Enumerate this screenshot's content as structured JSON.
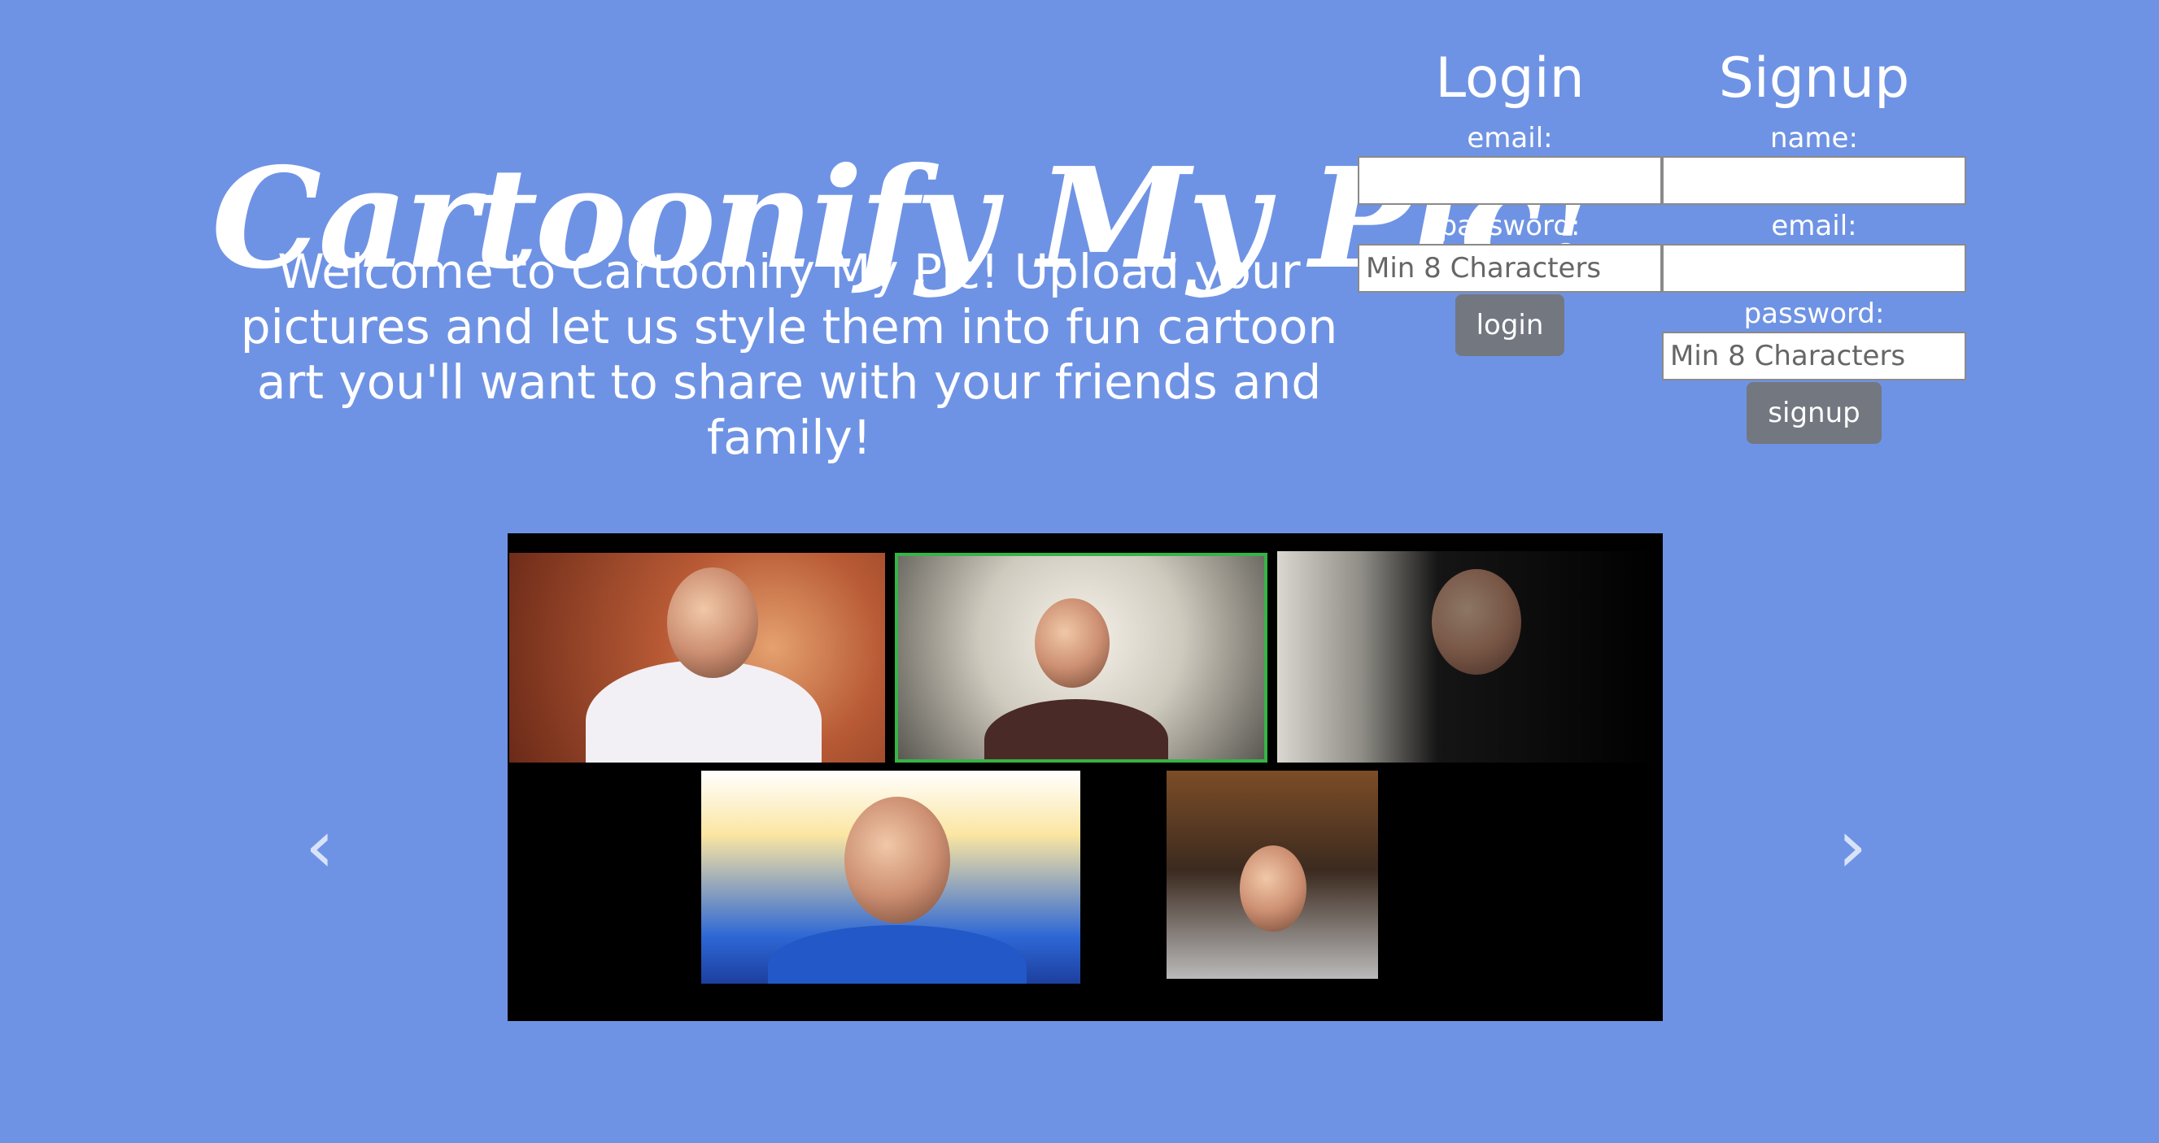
{
  "header": {
    "title": "Cartoonify My Pic!",
    "intro": "Welcome to Cartoonify My Pic! Upload your pictures and let us style them into fun cartoon art you'll want to share with your friends and family!"
  },
  "login": {
    "title": "Login",
    "email_label": "email:",
    "password_label": "password:",
    "email_value": "",
    "password_placeholder": "Min 8 Characters",
    "button_label": "login"
  },
  "signup": {
    "title": "Signup",
    "name_label": "name:",
    "email_label": "email:",
    "password_label": "password:",
    "name_value": "",
    "email_value": "",
    "password_placeholder": "Min 8 Characters",
    "button_label": "signup"
  },
  "carousel": {
    "prev_icon": "chevron-left-icon",
    "next_icon": "chevron-right-icon",
    "prev_glyph": "‹",
    "next_glyph": "›"
  },
  "colors": {
    "background": "#6f93e4",
    "button": "#737780",
    "text": "#ffffff"
  }
}
